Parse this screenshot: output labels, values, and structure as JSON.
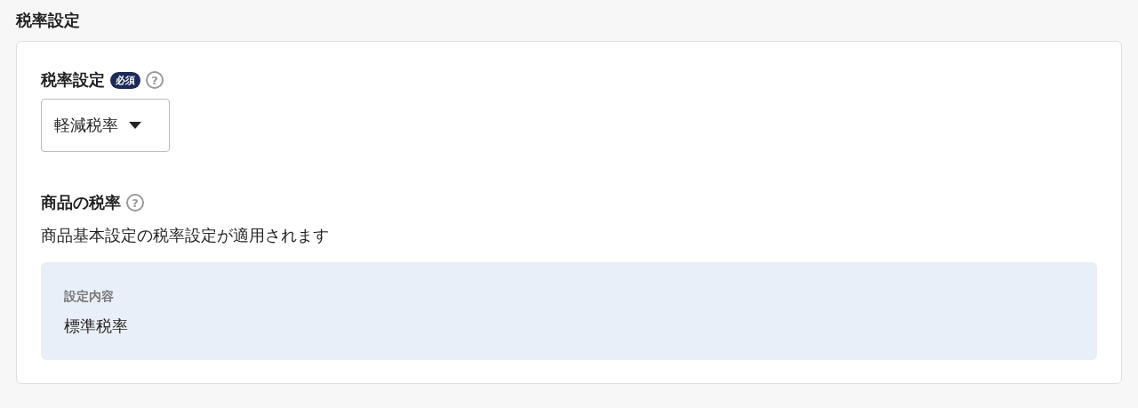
{
  "section_title": "税率設定",
  "tax_setting": {
    "label": "税率設定",
    "badge": "必須",
    "help": "?",
    "select": {
      "value": "軽減税率"
    }
  },
  "product_tax": {
    "label": "商品の税率",
    "help": "?",
    "description": "商品基本設定の税率設定が適用されます",
    "info": {
      "heading": "設定内容",
      "value": "標準税率"
    }
  }
}
